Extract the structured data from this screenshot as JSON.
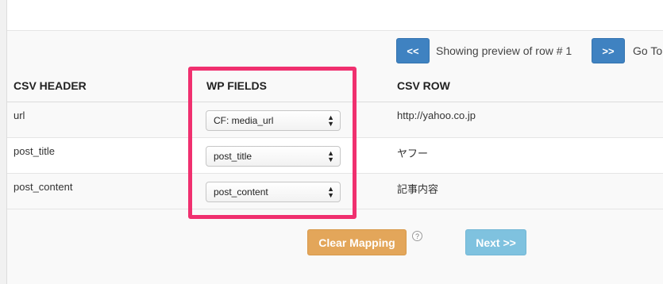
{
  "nav": {
    "prev_label": "<<",
    "preview_text": "Showing preview of row # 1",
    "next_label": ">>",
    "goto_text": "Go To"
  },
  "table": {
    "headers": [
      "CSV HEADER",
      "WP FIELDS",
      "CSV ROW"
    ],
    "rows": [
      {
        "csv_header": "url",
        "wp_field": "CF: media_url",
        "csv_row": "http://yahoo.co.jp"
      },
      {
        "csv_header": "post_title",
        "wp_field": "post_title",
        "csv_row": "ヤフー"
      },
      {
        "csv_header": "post_content",
        "wp_field": "post_content",
        "csv_row": "記事内容"
      }
    ]
  },
  "actions": {
    "clear_mapping_label": "Clear Mapping",
    "help_label": "?",
    "next_label": "Next >>"
  },
  "colors": {
    "highlight": "#f0306f",
    "nav_button": "#3f82c1",
    "clear_button": "#e3a65a",
    "next_button": "#7fc2df"
  }
}
